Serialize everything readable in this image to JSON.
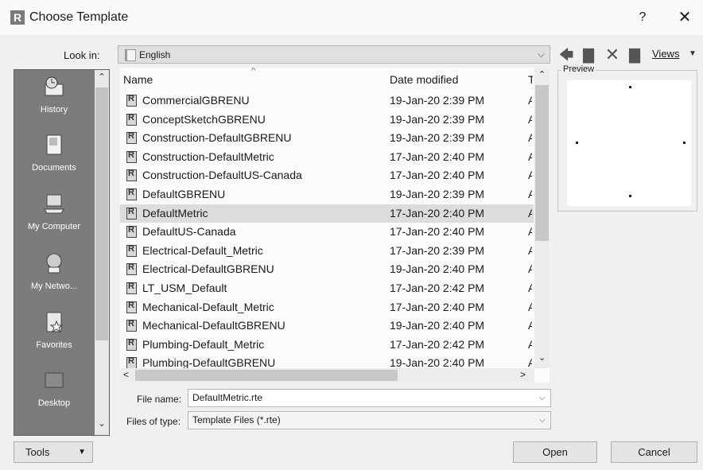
{
  "window": {
    "title": "Choose Template",
    "app_icon_letter": "R",
    "help_label": "?",
    "close_label": "✕"
  },
  "lookin": {
    "label": "Look in:",
    "value": "English"
  },
  "toolbar": {
    "back_glyph": "🡄",
    "up_glyph": "▇",
    "delete_glyph": "✕",
    "newfolder_glyph": "▇",
    "views_label": "Views",
    "views_arrow": "▼"
  },
  "places": [
    {
      "label": "History",
      "icon": "history-icon"
    },
    {
      "label": "Documents",
      "icon": "documents-icon"
    },
    {
      "label": "My Computer",
      "icon": "computer-icon"
    },
    {
      "label": "My Netwo...",
      "icon": "network-icon"
    },
    {
      "label": "Favorites",
      "icon": "favorites-icon"
    },
    {
      "label": "Desktop",
      "icon": "desktop-icon"
    }
  ],
  "columns": {
    "name": "Name",
    "date": "Date modified",
    "type": "T"
  },
  "files": [
    {
      "name": "CommercialGBRENU",
      "date": "19-Jan-20 2:39 PM",
      "type": "A"
    },
    {
      "name": "ConceptSketchGBRENU",
      "date": "19-Jan-20 2:39 PM",
      "type": "A"
    },
    {
      "name": "Construction-DefaultGBRENU",
      "date": "19-Jan-20 2:39 PM",
      "type": "A"
    },
    {
      "name": "Construction-DefaultMetric",
      "date": "17-Jan-20 2:40 PM",
      "type": "A"
    },
    {
      "name": "Construction-DefaultUS-Canada",
      "date": "17-Jan-20 2:40 PM",
      "type": "A"
    },
    {
      "name": "DefaultGBRENU",
      "date": "19-Jan-20 2:39 PM",
      "type": "A"
    },
    {
      "name": "DefaultMetric",
      "date": "17-Jan-20 2:40 PM",
      "type": "A",
      "selected": true
    },
    {
      "name": "DefaultUS-Canada",
      "date": "17-Jan-20 2:40 PM",
      "type": "A"
    },
    {
      "name": "Electrical-Default_Metric",
      "date": "17-Jan-20 2:39 PM",
      "type": "A"
    },
    {
      "name": "Electrical-DefaultGBRENU",
      "date": "19-Jan-20 2:40 PM",
      "type": "A"
    },
    {
      "name": "LT_USM_Default",
      "date": "17-Jan-20 2:42 PM",
      "type": "A"
    },
    {
      "name": "Mechanical-Default_Metric",
      "date": "17-Jan-20 2:40 PM",
      "type": "A"
    },
    {
      "name": "Mechanical-DefaultGBRENU",
      "date": "19-Jan-20 2:40 PM",
      "type": "A"
    },
    {
      "name": "Plumbing-Default_Metric",
      "date": "17-Jan-20 2:42 PM",
      "type": "A"
    },
    {
      "name": "Plumbing-DefaultGBRENU",
      "date": "19-Jan-20 2:40 PM",
      "type": "A"
    }
  ],
  "preview": {
    "label": "Preview"
  },
  "filename": {
    "label": "File name:",
    "value": "DefaultMetric.rte"
  },
  "filetype": {
    "label": "Files of type:",
    "value": "Template Files  (*.rte)"
  },
  "buttons": {
    "tools": "Tools",
    "open": "Open",
    "cancel": "Cancel"
  },
  "colors": {
    "places_bg": "#7c7c7c",
    "selected_row": "#dcdcdc",
    "window_bg": "#f0f0f0"
  }
}
